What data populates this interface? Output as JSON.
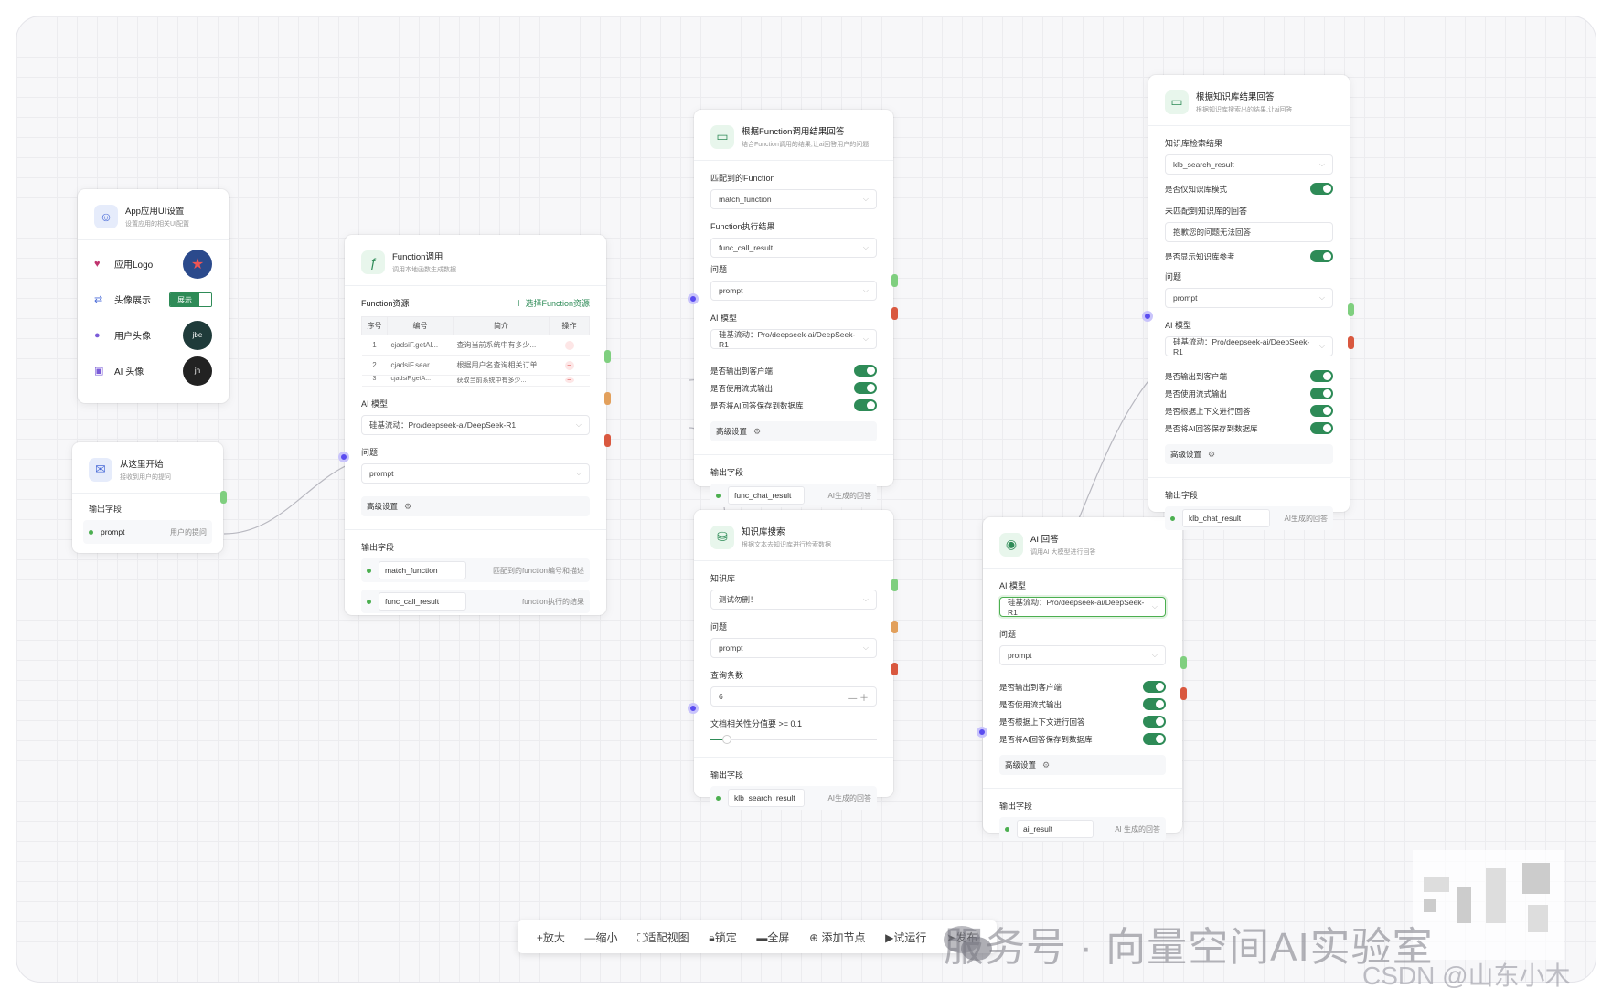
{
  "colors": {
    "accent_green": "#2e8b57",
    "port_purple": "#5a4cf0",
    "port_green": "#7fcf7f",
    "port_orange": "#e2a05c",
    "port_red": "#d9583f"
  },
  "app_ui": {
    "title": "App应用UI设置",
    "subtitle": "设置应用的相关UI配置",
    "rows": [
      {
        "icon": "heart-icon",
        "label": "应用Logo"
      },
      {
        "icon": "arrows-icon",
        "label": "头像展示",
        "toggle_label": "展示"
      },
      {
        "icon": "user-icon",
        "label": "用户头像",
        "avatar_text": "jbe"
      },
      {
        "icon": "robot-icon",
        "label": "AI 头像",
        "avatar_text": "jn"
      }
    ]
  },
  "start": {
    "title": "从这里开始",
    "subtitle": "接收到用户的提问",
    "output_label": "输出字段",
    "output": {
      "field": "prompt",
      "desc": "用户的提问"
    }
  },
  "function_call": {
    "title": "Function调用",
    "subtitle": "调用本地函数生成数据",
    "resource_label": "Function资源",
    "choose_label": "选择Function资源",
    "table_headers": [
      "序号",
      "编号",
      "简介",
      "操作"
    ],
    "table_rows": [
      {
        "no": "1",
        "code": "cjadsiF.getAl...",
        "desc": "查询当前系统中有多少..."
      },
      {
        "no": "2",
        "code": "cjadsiF.sear...",
        "desc": "根据用户名查询相关订单"
      },
      {
        "no": "3",
        "code": "cjadsiF.getA...",
        "desc": "获取当前系统中有多少..."
      }
    ],
    "model_label": "AI 模型",
    "model_value": "硅基流动：Pro/deepseek-ai/DeepSeek-R1",
    "question_label": "问题",
    "question_value": "prompt",
    "advanced_label": "高级设置",
    "output_label": "输出字段",
    "outputs": [
      {
        "field": "match_function",
        "desc": "匹配到的function编号和描述"
      },
      {
        "field": "func_call_result",
        "desc": "function执行的结果"
      }
    ]
  },
  "func_answer": {
    "title": "根据Function调用结果回答",
    "subtitle": "结合Function调用的结果,让ai回答用户的问题",
    "match_label": "匹配到的Function",
    "match_value": "match_function",
    "exec_label": "Function执行结果",
    "exec_value": "func_call_result",
    "question_label": "问题",
    "question_value": "prompt",
    "model_label": "AI 模型",
    "model_value": "硅基流动：Pro/deepseek-ai/DeepSeek-R1",
    "toggles": [
      "是否输出到客户端",
      "是否使用流式输出",
      "是否将AI回答保存到数据库"
    ],
    "advanced_label": "高级设置",
    "output_label": "输出字段",
    "output": {
      "field": "func_chat_result",
      "desc": "AI生成的回答"
    }
  },
  "kb_search": {
    "title": "知识库搜索",
    "subtitle": "根据文本去知识库进行检索数据",
    "kb_label": "知识库",
    "kb_value": "测试勿删！",
    "question_label": "问题",
    "question_value": "prompt",
    "count_label": "查询条数",
    "count_value": "6",
    "score_label": "文档相关性分值要 >= 0.1",
    "score_value": 0.1,
    "output_label": "输出字段",
    "output": {
      "field": "klb_search_result",
      "desc": "AI生成的回答"
    }
  },
  "kb_answer": {
    "title": "根据知识库结果回答",
    "subtitle": "根据知识库搜索出的结果,让ai回答",
    "result_label": "知识库检索结果",
    "result_value": "klb_search_result",
    "only_kb_label": "是否仅知识库模式",
    "unmatched_label": "未匹配到知识库的回答",
    "unmatched_value": "抱歉您的问题无法回答",
    "show_ref_label": "是否显示知识库参考",
    "question_label": "问题",
    "question_value": "prompt",
    "model_label": "AI 模型",
    "model_value": "硅基流动：Pro/deepseek-ai/DeepSeek-R1",
    "toggles": [
      "是否输出到客户端",
      "是否使用流式输出",
      "是否根据上下文进行回答",
      "是否将AI回答保存到数据库"
    ],
    "advanced_label": "高级设置",
    "output_label": "输出字段",
    "output": {
      "field": "klb_chat_result",
      "desc": "AI生成的回答"
    }
  },
  "ai_answer": {
    "title": "AI 回答",
    "subtitle": "调用AI 大模型进行回答",
    "model_label": "AI 模型",
    "model_value": "硅基流动：Pro/deepseek-ai/DeepSeek-R1",
    "question_label": "问题",
    "question_value": "prompt",
    "toggles": [
      "是否输出到客户端",
      "是否使用流式输出",
      "是否根据上下文进行回答",
      "是否将AI回答保存到数据库"
    ],
    "advanced_label": "高级设置",
    "output_label": "输出字段",
    "output": {
      "field": "ai_result",
      "desc": "AI 生成的回答"
    }
  },
  "toolbar": {
    "zoom_in": "+放大",
    "zoom_out": "—缩小",
    "fit_view": "适配视图",
    "lock": "锁定",
    "fullscreen": "全屏",
    "add_node": "添加节点",
    "test_run": "试运行",
    "publish": "发布"
  },
  "watermark": {
    "text": "服务号 · 向量空间AI实验室",
    "csdn": "CSDN @山东小木"
  }
}
